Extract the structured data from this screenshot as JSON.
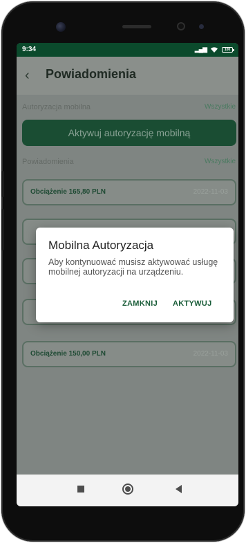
{
  "status_bar": {
    "time": "9:34",
    "signal_icon": "signal-icon",
    "wifi_icon": "wifi-icon",
    "battery_icon": "battery-icon",
    "battery_text": "100"
  },
  "header": {
    "back_icon": "chevron-left-icon",
    "title": "Powiadomienia"
  },
  "mobile_auth_section": {
    "label": "Autoryzacja mobilna",
    "link": "Wszystkie",
    "activate_button": "Aktywuj autoryzację mobilną"
  },
  "notifications_section": {
    "label": "Powiadomienia",
    "link": "Wszystkie",
    "items": [
      {
        "title": "Obciążenie 165,80 PLN",
        "date": "2022-11-03"
      },
      {
        "title": "",
        "date": ""
      },
      {
        "title": "",
        "date": ""
      },
      {
        "title": "",
        "date": ""
      },
      {
        "title": "Obciążenie 150,00 PLN",
        "date": "2022-11-03"
      }
    ]
  },
  "dialog": {
    "title": "Mobilna Autoryzacja",
    "message": "Aby kontynuować musisz aktywować usługę mobilnej autoryzacji na urządzeniu.",
    "close_label": "ZAMKNIJ",
    "activate_label": "AKTYWUJ"
  },
  "colors": {
    "brand_green": "#0b4a2c",
    "button_green": "#1b5e3a",
    "overlay_gray": "#7f8582"
  }
}
